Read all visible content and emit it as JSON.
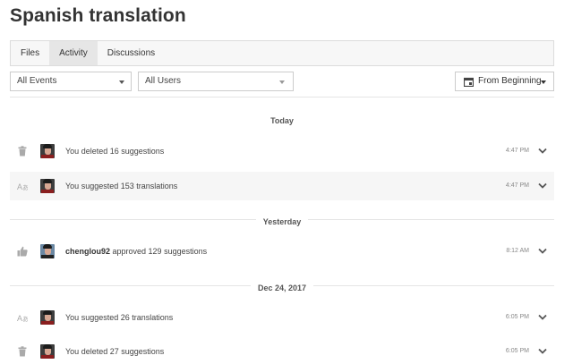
{
  "page": {
    "title": "Spanish translation"
  },
  "tabs": [
    {
      "label": "Files",
      "active": false
    },
    {
      "label": "Activity",
      "active": true
    },
    {
      "label": "Discussions",
      "active": false
    }
  ],
  "filters": {
    "events": {
      "selected": "All Events"
    },
    "users": {
      "selected": "All Users"
    },
    "date": {
      "label": "From Beginning"
    }
  },
  "groups": [
    {
      "label": "Today",
      "items": [
        {
          "icon": "trash-icon",
          "user": "",
          "action": "You deleted 16 suggestions",
          "time": "4:47 PM",
          "shaded": false
        },
        {
          "icon": "translate-icon",
          "user": "",
          "action": "You suggested 153 translations",
          "time": "4:47 PM",
          "shaded": true
        }
      ]
    },
    {
      "label": "Yesterday",
      "items": [
        {
          "icon": "thumbs-up-icon",
          "user": "chenglou92",
          "action": " approved 129 suggestions",
          "time": "8:12 AM",
          "shaded": false
        }
      ]
    },
    {
      "label": "Dec 24, 2017",
      "items": [
        {
          "icon": "translate-icon",
          "user": "",
          "action": "You suggested 26 translations",
          "time": "6:05 PM",
          "shaded": false
        },
        {
          "icon": "trash-icon",
          "user": "",
          "action": "You deleted 27 suggestions",
          "time": "6:05 PM",
          "shaded": false
        }
      ]
    }
  ],
  "colors": {
    "tab_active": "#e6e6e6",
    "row_shaded": "#f6f6f6",
    "icon_gray": "#aaaaaa"
  }
}
